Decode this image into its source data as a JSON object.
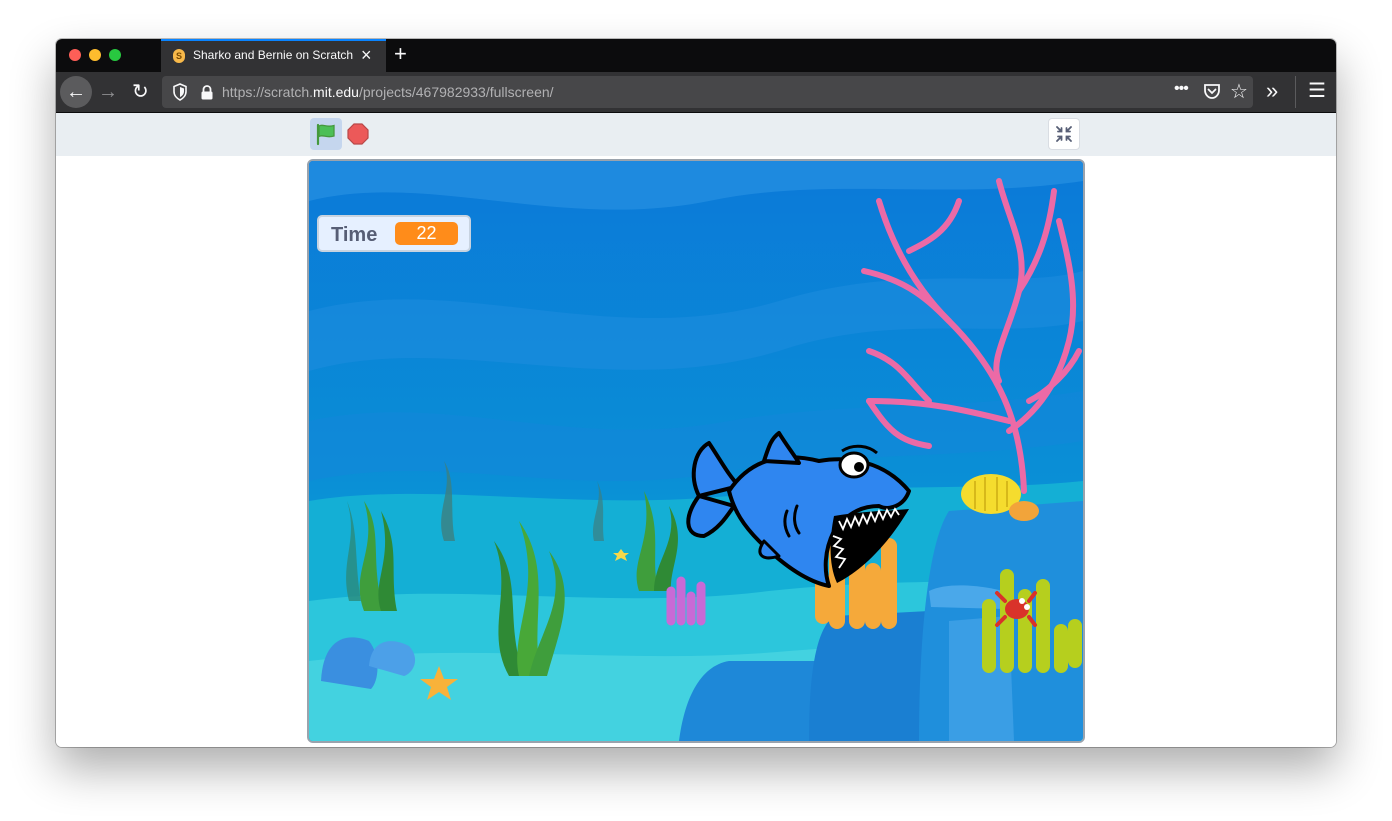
{
  "browser": {
    "tab_title": "Sharko and Bernie on Scratch",
    "favicon_icon": "scratch-cat-icon",
    "url_prefix": "https://scratch.",
    "url_host": "mit.edu",
    "url_path": "/projects/467982933/fullscreen/"
  },
  "stage": {
    "monitor": {
      "label": "Time",
      "value": "22",
      "value_color": "#ff8c1a"
    },
    "sprites": [
      "shark",
      "crab",
      "starfish",
      "coral",
      "seaweed",
      "rocks"
    ]
  },
  "colors": {
    "flag_active_bg": "#c5d6ee",
    "controls_bg": "#e9eef2",
    "stop_red": "#ec5959",
    "flag_green": "#4cbf56"
  }
}
